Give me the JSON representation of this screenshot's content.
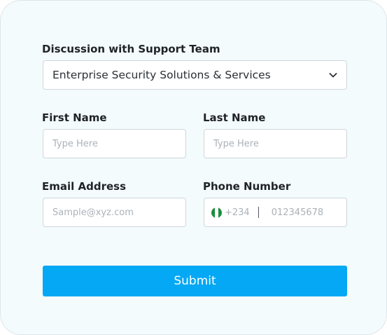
{
  "form": {
    "discussion": {
      "label": "Discussion with Support Team",
      "selected_value": "Enterprise Security Solutions & Services"
    },
    "first_name": {
      "label": "First Name",
      "placeholder": "Type Here"
    },
    "last_name": {
      "label": "Last Name",
      "placeholder": "Type Here"
    },
    "email": {
      "label": "Email Address",
      "placeholder": "Sample@xyz.com"
    },
    "phone": {
      "label": "Phone Number",
      "country_flag": "nigeria-flag-icon",
      "country_code": "+234",
      "placeholder": "012345678"
    },
    "submit_label": "Submit"
  },
  "colors": {
    "card_background": "#f4fbfc",
    "accent": "#05a8f4",
    "label_text": "#1f2328",
    "placeholder_text": "#aab2b9"
  }
}
